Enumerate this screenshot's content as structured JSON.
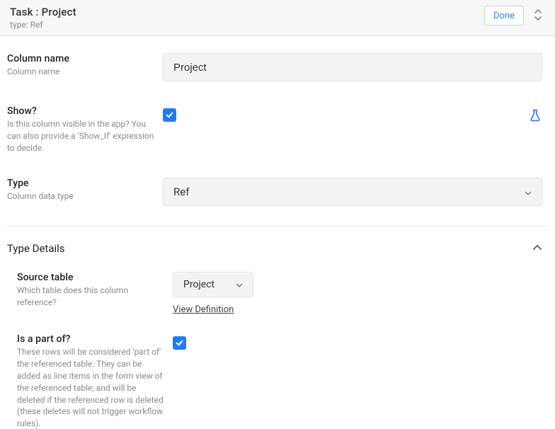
{
  "header": {
    "title": "Task : Project",
    "type_prefix": "type: ",
    "type_value": "Ref",
    "done_label": "Done"
  },
  "fields": {
    "column_name": {
      "label": "Column name",
      "desc": "Column name",
      "value": "Project"
    },
    "show": {
      "label": "Show?",
      "desc": "Is this column visible in the app? You can also provide a 'Show_If' expression to decide.",
      "checked": true
    },
    "type": {
      "label": "Type",
      "desc": "Column data type",
      "value": "Ref"
    }
  },
  "details": {
    "title": "Type Details",
    "source_table": {
      "label": "Source table",
      "desc": "Which table does this column reference?",
      "value": "Project",
      "view_definition": "View Definition"
    },
    "is_part_of": {
      "label": "Is a part of?",
      "desc": "These rows will be considered 'part of' the referenced table. They can be added as line items in the form view of the referenced table, and will be deleted if the referenced row is deleted (these deletes will not trigger workflow rules).",
      "checked": true
    }
  }
}
